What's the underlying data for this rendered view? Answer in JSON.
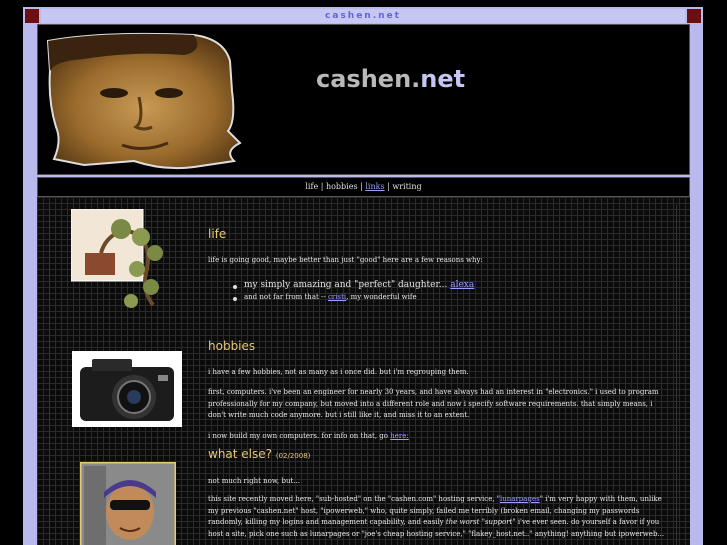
{
  "topbar": {
    "title": "cashen.net"
  },
  "header": {
    "title_part1": "cashen.",
    "title_part2": "net"
  },
  "nav": {
    "items": [
      {
        "label": "life",
        "link": false
      },
      {
        "label": "hobbies",
        "link": false
      },
      {
        "label": "links",
        "link": true
      },
      {
        "label": "writing",
        "link": false
      }
    ],
    "separator": " | "
  },
  "life": {
    "heading": "life",
    "intro": "life is going good, maybe better than just \"good\" here are a few reasons why:",
    "item1_text": "my simply amazing and \"perfect\" daughter...",
    "item1_link": "alexa",
    "item2_text": "and not far from that --",
    "item2_link": "cristi",
    "item2_suffix": ", my wonderful wife"
  },
  "hobbies": {
    "heading": "hobbies",
    "p1": "i have a few hobbies, not as many as i once did. but i'm regrouping them.",
    "p2": "first, computers. i've been an engineer for nearly 30 years, and have always had an interest in \"electronics.\" i used to program professionally for my company, but moved into a different role and now i specify software requirements. that simply means, i don't write much code anymore. but i still like it, and miss it to an extent.",
    "p3_text": "i now build my own computers. for info on that, go",
    "p3_link": "here:"
  },
  "whatelse": {
    "heading": "what else?",
    "date": "(02/2008)",
    "p1": "not much right now, but...",
    "p2_a": "this site recently moved here, \"sub-hosted\" on the \"cashen.com\" hosting service, \"",
    "p2_link": "lunarpages",
    "p2_b": "\" i'm very happy with them, unlike my previous \"cashen.net\" host, \"ipowerweb,\" who, quite simply, failed me terribly (broken email, changing my passwords randomly, killing my logins and management capability, and easily",
    "p2_em": "the worst \"support\"",
    "p2_c": "i've ever seen. do yourself a favor if you host a site, pick one such as lunarpages or \"joe's cheap hosting service,\" \"flakey_host.net..\" anything! anything but ipowerweb..."
  },
  "colors": {
    "accent_heading": "#e6c875",
    "link": "#9aa0ff",
    "frame": "#b9b9ee",
    "corner": "#6b0f12"
  }
}
